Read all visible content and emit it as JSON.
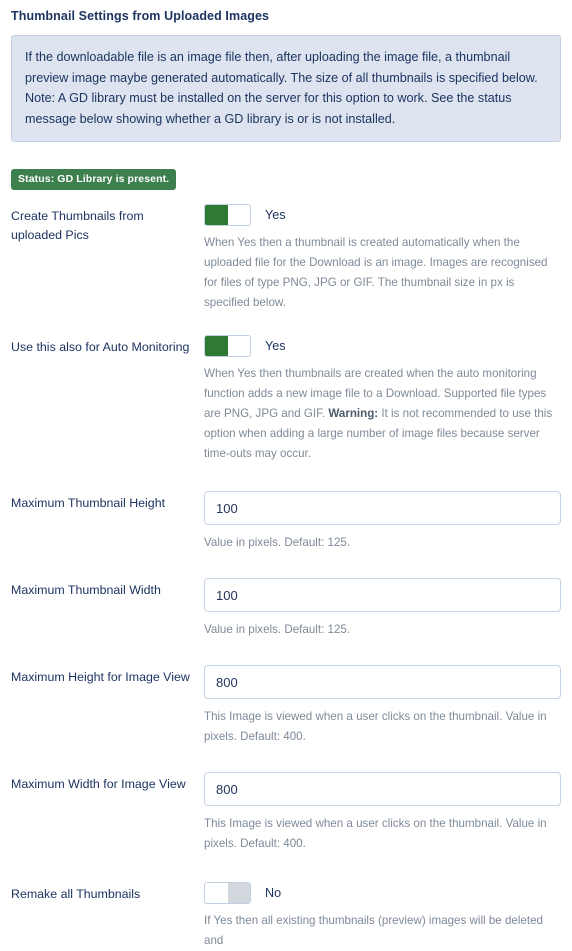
{
  "section": {
    "title": "Thumbnail Settings from Uploaded Images"
  },
  "notice": {
    "text": "If the downloadable file is an image file then, after uploading the image file, a thumbnail preview image maybe generated automatically. The size of all thumbnails is specified below. Note: A GD library must be installed on the server for this option to work. See the status message below showing whether a GD library is or is not installed."
  },
  "status": {
    "badge_label": "Status: GD Library is present.",
    "badge_color": "#3d7f4d"
  },
  "colors": {
    "accent_green": "#2f7a33",
    "label_navy": "#1d3461",
    "notice_bg": "#dde4f0",
    "notice_border": "#c3cede",
    "input_border": "#c4d2e6",
    "help_gray": "#7e8a98",
    "toggle_off": "#d3d8de"
  },
  "rows": {
    "create_thumbnails": {
      "label": "Create Thumbnails from uploaded Pics",
      "toggle_state": "on",
      "toggle_value": "Yes",
      "help": "When Yes then a thumbnail is created automatically when the uploaded file for the Download is an image. Images are recognised for files of type PNG, JPG or GIF. The thumbnail size in px is specified below."
    },
    "auto_monitoring": {
      "label": "Use this also for Auto Monitoring",
      "toggle_state": "on",
      "toggle_value": "Yes",
      "help_part1": "When Yes then thumbnails are created when the auto monitoring function adds a new image file to a Download. Supported file types are PNG, JPG and GIF. ",
      "help_warning": "Warning:",
      "help_part2": " It is not recommended to use this option when adding a large number of image files because server time-outs may occur."
    },
    "max_thumb_height": {
      "label": "Maximum Thumbnail Height",
      "value": "100",
      "placeholder": "125",
      "help": "Value in pixels. Default: 125."
    },
    "max_thumb_width": {
      "label": "Maximum Thumbnail Width",
      "value": "100",
      "placeholder": "125",
      "help": "Value in pixels. Default: 125."
    },
    "max_height_image_view": {
      "label": "Maximum Height for Image View",
      "value": "800",
      "placeholder": "400",
      "help": "This Image is viewed when a user clicks on the thumbnail. Value in pixels. Default: 400."
    },
    "max_width_image_view": {
      "label": "Maximum Width for Image View",
      "value": "800",
      "placeholder": "400",
      "help": "This Image is viewed when a user clicks on the thumbnail. Value in pixels. Default: 400."
    },
    "remake_all_thumbnails": {
      "label": "Remake all Thumbnails",
      "toggle_state": "off",
      "toggle_value": "No",
      "help": "If Yes then all existing thumbnails (preview) images will be deleted and"
    }
  }
}
